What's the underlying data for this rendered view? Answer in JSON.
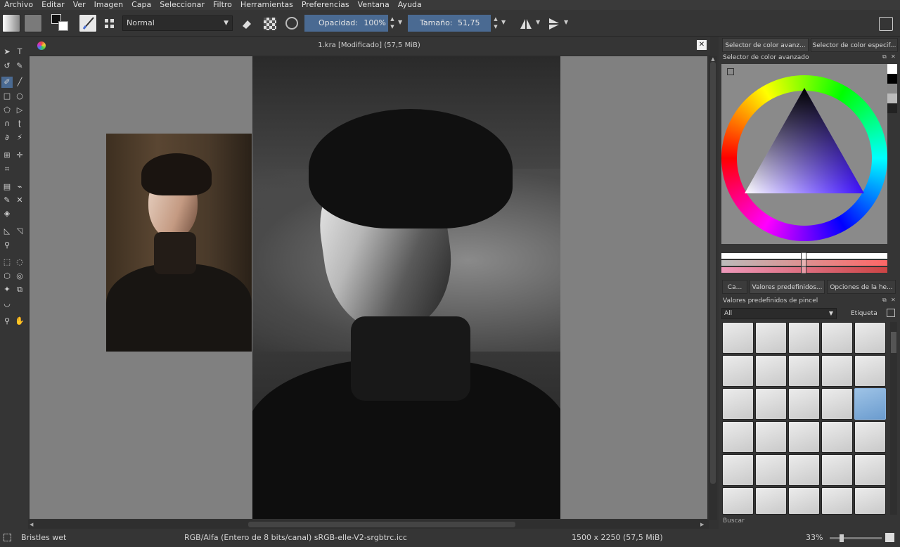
{
  "menu": [
    "Archivo",
    "Editar",
    "Ver",
    "Imagen",
    "Capa",
    "Seleccionar",
    "Filtro",
    "Herramientas",
    "Preferencias",
    "Ventana",
    "Ayuda"
  ],
  "toolbar": {
    "blend_mode": "Normal",
    "opacity_label": "Opacidad:",
    "opacity_value": "100%",
    "size_label": "Tamaño:",
    "size_value": "51,75 px"
  },
  "document": {
    "title": "1.kra [Modificado]  (57,5 MiB)"
  },
  "dock": {
    "top_tabs": [
      "Selector de color avanz...",
      "Selector de color especif..."
    ],
    "color_panel_title": "Selector de color avanzado",
    "bottom_tabs": [
      "Ca...",
      "Valores predefinidos...",
      "Opciones de la he..."
    ],
    "presets_panel_title": "Valores predefinidos de pincel",
    "filter_value": "All",
    "tag_label": "Etiqueta",
    "search_placeholder": "Buscar"
  },
  "status": {
    "brush_name": "Bristles wet",
    "color_info": "RGB/Alfa (Entero de 8 bits/canal)  sRGB-elle-V2-srgbtrc.icc",
    "dimensions": "1500 x 2250 (57,5 MiB)",
    "zoom": "33%"
  },
  "colors": {
    "accent": "#4a6a92",
    "canvas_bg": "#808080",
    "panel_bg": "#353535"
  }
}
